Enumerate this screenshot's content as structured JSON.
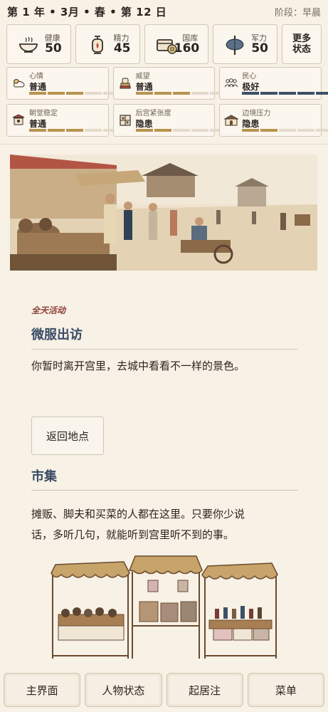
{
  "header": {
    "date": "第 1 年 • 3月 • 春 • 第 12 日",
    "phase": "阶段：早晨"
  },
  "stats": [
    {
      "label": "健康",
      "value": "50",
      "icon": "bowl-icon"
    },
    {
      "label": "精力",
      "value": "45",
      "icon": "lantern-icon"
    },
    {
      "label": "国库",
      "value": "160",
      "icon": "treasury-chest-icon"
    },
    {
      "label": "军力",
      "value": "50",
      "icon": "axe-icon"
    }
  ],
  "more_label": "更多\n状态",
  "meters": [
    {
      "label": "心情",
      "value": "普通",
      "icon": "weather-icon",
      "level": 3,
      "max": 5,
      "color": "#b8944f"
    },
    {
      "label": "威望",
      "value": "普通",
      "icon": "seal-icon",
      "level": 3,
      "max": 5,
      "color": "#b8944f"
    },
    {
      "label": "民心",
      "value": "极好",
      "icon": "people-icon",
      "level": 5,
      "max": 5,
      "color": "#3c5068"
    },
    {
      "label": "朝堂稳定",
      "value": "普通",
      "icon": "court-icon",
      "level": 3,
      "max": 5,
      "color": "#b8944f"
    },
    {
      "label": "后宫紧张度",
      "value": "隐患",
      "icon": "window-icon",
      "level": 2,
      "max": 5,
      "color": "#b8944f"
    },
    {
      "label": "边境压力",
      "value": "隐患",
      "icon": "fortress-icon",
      "level": 2,
      "max": 5,
      "color": "#b8944f"
    }
  ],
  "event": {
    "tag": "全天活动",
    "title": "微服出访",
    "text": "你暂时离开宫里，去城中看看不一样的景色。",
    "back_label": "返回地点"
  },
  "location": {
    "title": "市集",
    "text_line1": "摊贩、脚夫和买菜的人都在这里。只要你少说",
    "text_line2": "话，多听几句，就能听到宫里听不到的事。"
  },
  "nav": [
    "主界面",
    "人物状态",
    "起居注",
    "菜单"
  ]
}
